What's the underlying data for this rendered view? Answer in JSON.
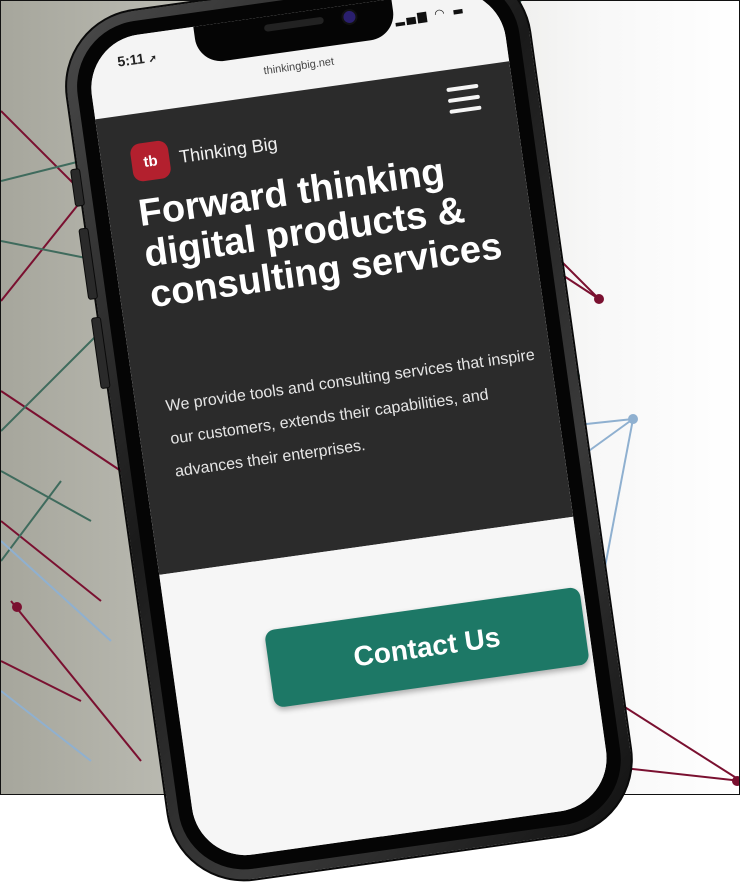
{
  "status_bar": {
    "time": "5:11",
    "url": "thinkingbig.net"
  },
  "site": {
    "logo_text": "tb",
    "brand_name": "Thinking Big",
    "headline": "Forward thinking digital products & consulting services",
    "description": "We provide tools and consulting services that inspire our customers, extends their capabilities, and advances their enterprises.",
    "contact_button": "Contact Us"
  },
  "colors": {
    "brand_red": "#b3202e",
    "hero_background": "#2b2b2b",
    "cta_green": "#1d7866",
    "network_maroon": "#7a1030",
    "network_teal": "#3f6b5d",
    "network_blue": "#8fb0d0"
  },
  "icons": {
    "menu": "hamburger-menu-icon",
    "signal": "signal-icon",
    "wifi": "wifi-icon",
    "battery": "battery-icon",
    "location": "location-arrow-icon"
  }
}
